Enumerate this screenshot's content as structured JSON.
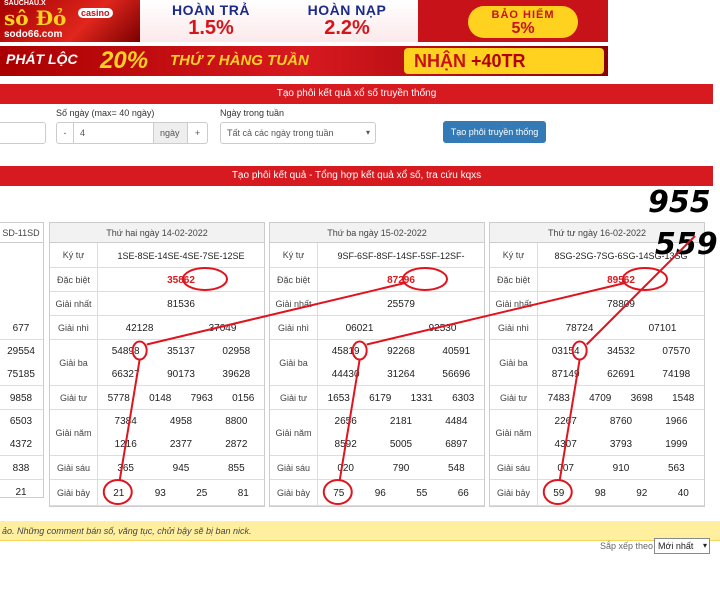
{
  "banner_top": {
    "logo_small": "SAUCHAU.X",
    "logo_text": "sô Đỏ",
    "logo_badge": "casino",
    "logo_url": "sodo66.com",
    "promo1_title": "HOÀN TRẢ",
    "promo1_value": "1.5%",
    "promo2_title": "HOÀN NẠP",
    "promo2_value": "2.2%",
    "promo3_title": "BẢO HIỂM",
    "promo3_value": "5%"
  },
  "banner_bottom": {
    "lead": "PHÁT LỘC",
    "percent": "20%",
    "mid": "THỨ 7 HÀNG TUẦN",
    "cta": "NHẬN",
    "cta_value": "+40TR"
  },
  "form": {
    "title": "Tạo phôi kết quả xổ số truyền thống",
    "days_label": "Số ngày",
    "days_hint": "(max= 40 ngày)",
    "minus": "-",
    "days_value": "4",
    "days_unit": "ngày",
    "plus": "+",
    "weekday_label": "Ngày trong tuần",
    "weekday_value": "Tất cả các ngày trong tuần",
    "submit": "Tạo phôi truyền thống"
  },
  "results_title": "Tạo phôi kết quả - Tổng hợp kết quả xổ số, tra cứu kqxs",
  "partial_column": {
    "code": "SD-11SD",
    "rows": [
      [
        "677"
      ],
      [
        "29554",
        "75185"
      ],
      [
        "9858"
      ],
      [
        "6503",
        "4372"
      ],
      [
        "838"
      ],
      [
        "21"
      ]
    ]
  },
  "labels": {
    "code": "Ký tự",
    "special": "Đặc biệt",
    "g1": "Giải nhất",
    "g2": "Giải nhì",
    "g3": "Giải ba",
    "g4": "Giải tư",
    "g5": "Giải năm",
    "g6": "Giải sáu",
    "g7": "Giải bảy"
  },
  "days": [
    {
      "date": "Thứ hai ngày 14-02-2022",
      "code": "1SE-8SE-14SE-4SE-7SE-12SE",
      "special": "35862",
      "g1": "81536",
      "g2": [
        "42128",
        "37049"
      ],
      "g3": [
        "54898",
        "35137",
        "02958",
        "66327",
        "90173",
        "39628"
      ],
      "g4": [
        "5778",
        "0148",
        "7963",
        "0156"
      ],
      "g5": [
        "7384",
        "4958",
        "8800",
        "1216",
        "2377",
        "2872"
      ],
      "g6": [
        "365",
        "945",
        "855"
      ],
      "g7": [
        "21",
        "93",
        "25",
        "81"
      ]
    },
    {
      "date": "Thứ ba ngày 15-02-2022",
      "code": "9SF-6SF-8SF-14SF-5SF-12SF-",
      "special": "87296",
      "g1": "25579",
      "g2": [
        "06021",
        "92530"
      ],
      "g3": [
        "45819",
        "92268",
        "40591",
        "44430",
        "31264",
        "56696"
      ],
      "g4": [
        "1653",
        "6179",
        "1331",
        "6303"
      ],
      "g5": [
        "2656",
        "2181",
        "4484",
        "8592",
        "5005",
        "6897"
      ],
      "g6": [
        "020",
        "790",
        "548"
      ],
      "g7": [
        "75",
        "96",
        "55",
        "66"
      ]
    },
    {
      "date": "Thứ tư ngày 16-02-2022",
      "code": "8SG-2SG-7SG-6SG-14SG-13SG",
      "special": "89562",
      "g1": "78809",
      "g2": [
        "78724",
        "07101"
      ],
      "g3": [
        "03154",
        "34532",
        "07570",
        "87149",
        "62691",
        "74198"
      ],
      "g4": [
        "7483",
        "4709",
        "3698",
        "1548"
      ],
      "g5": [
        "2267",
        "8760",
        "1966",
        "4307",
        "3793",
        "1999"
      ],
      "g6": [
        "007",
        "910",
        "563"
      ],
      "g7": [
        "59",
        "98",
        "92",
        "40"
      ]
    }
  ],
  "annotations": {
    "top": "955",
    "bottom": "559"
  },
  "notice": "ảo. Những comment bán số, văng tục, chửi bậy sẽ bị ban nick.",
  "sort": {
    "label": "Sắp xếp theo",
    "value": "Mới nhất"
  },
  "colors": {
    "accent_red": "#d71920",
    "button_blue": "#337ab7",
    "notice_yellow": "#ffef9e",
    "annotation_red": "#e0141e"
  }
}
